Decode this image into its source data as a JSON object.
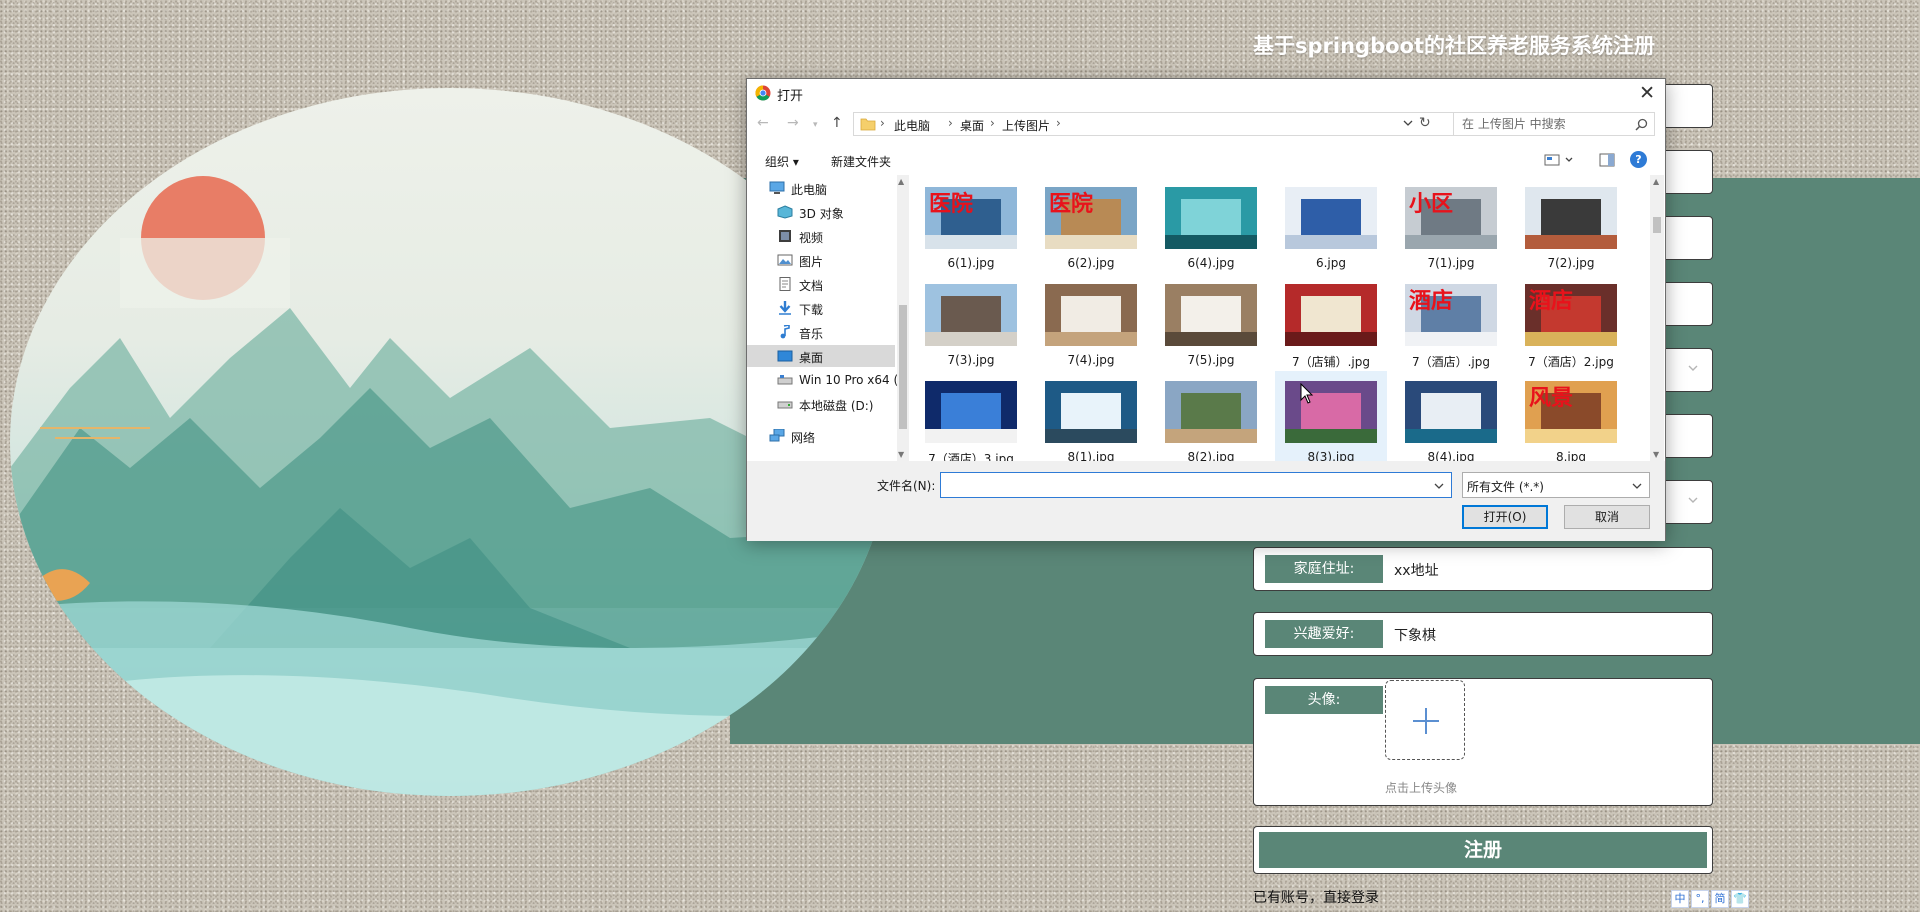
{
  "form": {
    "title": "基于springboot的社区养老服务系统注册",
    "fields": [
      {
        "label": "家庭住址:",
        "value": "xx地址"
      },
      {
        "label": "兴趣爱好:",
        "value": "下象棋"
      }
    ],
    "avatar": {
      "label": "头像:",
      "hint": "点击上传头像"
    },
    "register_label": "注册",
    "login_link": "已有账号，直接登录",
    "ime_chars": [
      "中",
      "°,",
      "简",
      "👕"
    ]
  },
  "dialog": {
    "title": "打开",
    "close_glyph": "✕",
    "breadcrumb": [
      "此电脑",
      "桌面",
      "上传图片"
    ],
    "search_placeholder": "在 上传图片 中搜索",
    "toolbar": {
      "organize": "组织 ▾",
      "new_folder": "新建文件夹",
      "help": "?"
    },
    "nav_items": [
      {
        "label": "此电脑",
        "icon": "computer-icon"
      },
      {
        "label": "3D 对象",
        "icon": "cube-3d-icon"
      },
      {
        "label": "视频",
        "icon": "video-icon"
      },
      {
        "label": "图片",
        "icon": "pictures-icon"
      },
      {
        "label": "文档",
        "icon": "documents-icon"
      },
      {
        "label": "下载",
        "icon": "download-icon"
      },
      {
        "label": "音乐",
        "icon": "music-icon"
      },
      {
        "label": "桌面",
        "icon": "desktop-icon",
        "selected": true
      },
      {
        "label": "Win 10 Pro x64 (",
        "icon": "drive-icon"
      },
      {
        "label": "本地磁盘 (D:)",
        "icon": "drive-icon"
      },
      {
        "label": "网络",
        "icon": "network-icon"
      }
    ],
    "files": [
      {
        "name": "6(1).jpg",
        "thumb": "hospital",
        "text": "医院"
      },
      {
        "name": "6(2).jpg",
        "thumb": "hospital-low",
        "text": "医院"
      },
      {
        "name": "6(4).jpg",
        "thumb": "corridor"
      },
      {
        "name": "6.jpg",
        "thumb": "building-blue"
      },
      {
        "name": "7(1).jpg",
        "thumb": "clinic",
        "text": "小区"
      },
      {
        "name": "7(2).jpg",
        "thumb": "house"
      },
      {
        "name": "7(3).jpg",
        "thumb": "villa"
      },
      {
        "name": "7(4).jpg",
        "thumb": "bedroom"
      },
      {
        "name": "7(5).jpg",
        "thumb": "bedroom2"
      },
      {
        "name": "7（店铺）.jpg",
        "thumb": "storefront"
      },
      {
        "name": "7（酒店）.jpg",
        "thumb": "hotel",
        "text": "酒店"
      },
      {
        "name": "7（酒店）2.jpg",
        "thumb": "inn",
        "text": "酒店"
      },
      {
        "name": "7（酒店）3.jpg",
        "thumb": "night-hotel"
      },
      {
        "name": "8(1).jpg",
        "thumb": "sea"
      },
      {
        "name": "8(2).jpg",
        "thumb": "lake"
      },
      {
        "name": "8(3).jpg",
        "thumb": "flowers",
        "hover": true
      },
      {
        "name": "8(4).jpg",
        "thumb": "mountain-lake"
      },
      {
        "name": "8.jpg",
        "thumb": "boats",
        "text": "风景"
      }
    ],
    "filename_label": "文件名(N):",
    "filename_value": "",
    "file_type": "所有文件 (*.*)",
    "open_label": "打开(O)",
    "cancel_label": "取消"
  },
  "colors": {
    "accent_green": "#5a8677",
    "dialog_blue": "#0078d7",
    "thumb_red_text": "#e8121b"
  }
}
